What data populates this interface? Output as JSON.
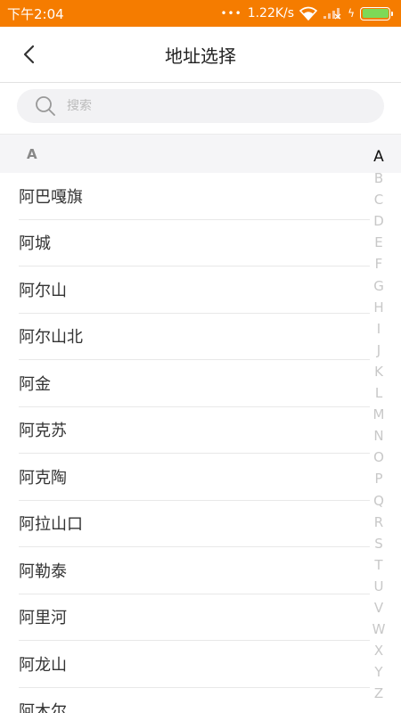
{
  "status_bar": {
    "time": "下午2:04",
    "dots": "•••",
    "speed": "1.22K/s",
    "bolt": "ϟ",
    "battery_level": 1.0,
    "background": "#f57c00",
    "battery_color": "#7ed957"
  },
  "nav": {
    "title": "地址选择",
    "back_icon": "chevron-left-icon"
  },
  "search": {
    "placeholder": "搜索",
    "value": "",
    "icon": "search-icon"
  },
  "section": {
    "letter": "A"
  },
  "cities": [
    {
      "name": "阿巴嘎旗"
    },
    {
      "name": "阿城"
    },
    {
      "name": "阿尔山"
    },
    {
      "name": "阿尔山北"
    },
    {
      "name": "阿金"
    },
    {
      "name": "阿克苏"
    },
    {
      "name": "阿克陶"
    },
    {
      "name": "阿拉山口"
    },
    {
      "name": "阿勒泰"
    },
    {
      "name": "阿里河"
    },
    {
      "name": "阿龙山"
    },
    {
      "name": "阿木尔"
    }
  ],
  "index": {
    "active": "A",
    "letters": [
      "A",
      "B",
      "C",
      "D",
      "E",
      "F",
      "G",
      "H",
      "I",
      "J",
      "K",
      "L",
      "M",
      "N",
      "O",
      "P",
      "Q",
      "R",
      "S",
      "T",
      "U",
      "V",
      "W",
      "X",
      "Y",
      "Z"
    ]
  }
}
